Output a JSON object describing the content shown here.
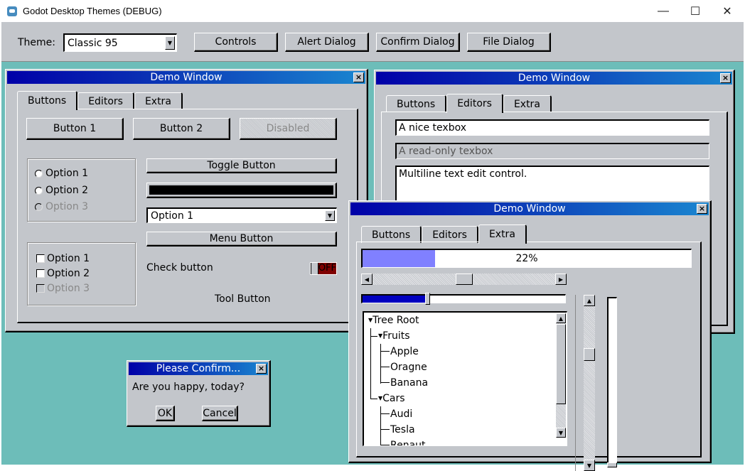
{
  "os_window": {
    "title": "Godot Desktop Themes (DEBUG)",
    "minimize": "—",
    "maximize": "☐",
    "close": "✕"
  },
  "toolbar": {
    "theme_label": "Theme:",
    "theme_value": "Classic 95",
    "buttons": [
      "Controls",
      "Alert Dialog",
      "Confirm Dialog",
      "File Dialog"
    ]
  },
  "window1": {
    "title": "Demo Window",
    "tabs": [
      "Buttons",
      "Editors",
      "Extra"
    ],
    "active_tab": "Buttons",
    "buttons": [
      "Button 1",
      "Button 2",
      "Disabled"
    ],
    "radios": [
      "Option 1",
      "Option 2",
      "Option 3"
    ],
    "checks": [
      "Option 1",
      "Option 2",
      "Option 3"
    ],
    "toggle_button": "Toggle Button",
    "color_picker_value": "#000000",
    "option_button": "Option 1",
    "menu_button": "Menu Button",
    "check_button_label": "Check button",
    "check_button_state": "OFF",
    "tool_button": "Tool Button"
  },
  "window2": {
    "title": "Demo Window",
    "tabs": [
      "Buttons",
      "Editors",
      "Extra"
    ],
    "active_tab": "Editors",
    "line_edit": "A nice texbox",
    "readonly_edit": "A read-only texbox",
    "text_edit": "Multiline text edit control."
  },
  "window3": {
    "title": "Demo Window",
    "tabs": [
      "Buttons",
      "Editors",
      "Extra"
    ],
    "active_tab": "Extra",
    "progress_label": "22%",
    "progress_value": 0.22,
    "hscroll_value": 0.5,
    "hslider_value": 0.32,
    "vscroll_value": 0.3,
    "vslider_value": 0.0,
    "tree": [
      {
        "label": "Tree Root",
        "level": 0,
        "expanded": true
      },
      {
        "label": "Fruits",
        "level": 1,
        "expanded": true
      },
      {
        "label": "Apple",
        "level": 2
      },
      {
        "label": "Oragne",
        "level": 2
      },
      {
        "label": "Banana",
        "level": 2
      },
      {
        "label": "Cars",
        "level": 1,
        "expanded": true
      },
      {
        "label": "Audi",
        "level": 2
      },
      {
        "label": "Tesla",
        "level": 2
      },
      {
        "label": "Renaut",
        "level": 2
      }
    ]
  },
  "confirm": {
    "title": "Please Confirm...",
    "message": "Are you happy, today?",
    "ok": "OK",
    "cancel": "Cancel"
  },
  "colors": {
    "desktop": "#6dbdb9",
    "face": "#c3c6cb",
    "title_start": "#0000a8",
    "title_end": "#1a86d0",
    "progress": "#8080ff",
    "slider": "#0000c0",
    "off": "#800000"
  }
}
